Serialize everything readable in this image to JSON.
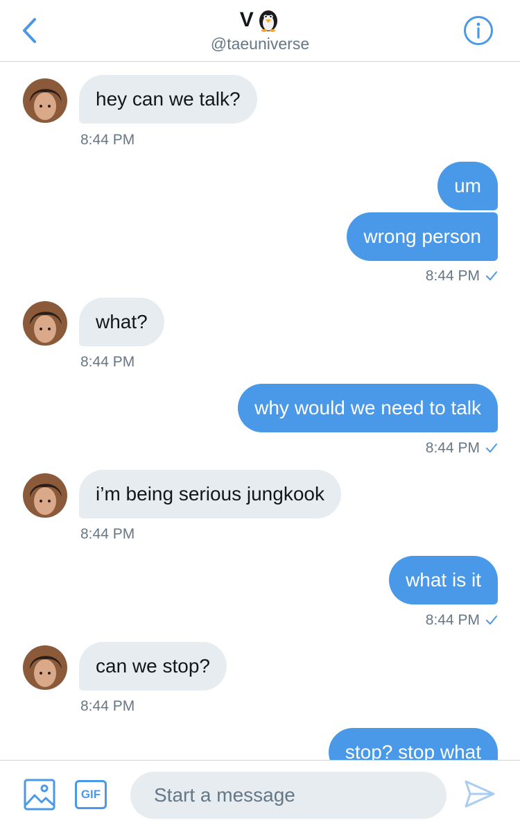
{
  "header": {
    "title": "V",
    "handle": "@taeuniverse",
    "title_icon": "penguin-emoji",
    "back_icon": "chevron-left-icon",
    "info_icon": "info-icon"
  },
  "colors": {
    "accent": "#4a99e9",
    "incoming_bubble": "#e6ecf0",
    "timestamp": "#657786"
  },
  "messages": [
    {
      "direction": "in",
      "text": "hey can we talk?",
      "time": "8:44 PM"
    },
    {
      "direction": "out",
      "text": "um"
    },
    {
      "direction": "out",
      "text": "wrong person",
      "time": "8:44 PM",
      "read": true
    },
    {
      "direction": "in",
      "text": "what?",
      "time": "8:44 PM"
    },
    {
      "direction": "out",
      "text": "why would we need to talk",
      "time": "8:44 PM",
      "read": true
    },
    {
      "direction": "in",
      "text": "i’m being serious jungkook",
      "time": "8:44 PM"
    },
    {
      "direction": "out",
      "text": "what is it",
      "time": "8:44 PM",
      "read": true
    },
    {
      "direction": "in",
      "text": "can we stop?",
      "time": "8:44 PM"
    },
    {
      "direction": "out",
      "text": "stop? stop what"
    }
  ],
  "composer": {
    "placeholder": "Start a message",
    "gif_label": "GIF",
    "image_icon": "image-icon",
    "send_icon": "send-icon"
  }
}
